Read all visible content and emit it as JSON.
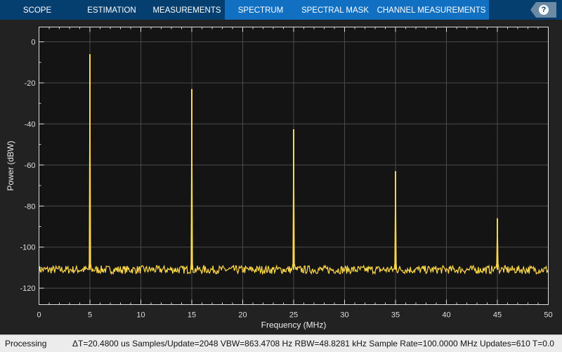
{
  "tabs": [
    {
      "label": "SCOPE",
      "active": false
    },
    {
      "label": "ESTIMATION",
      "active": false
    },
    {
      "label": "MEASUREMENTS",
      "active": false
    },
    {
      "label": "SPECTRUM",
      "active": true
    },
    {
      "label": "SPECTRAL MASK",
      "active": true
    },
    {
      "label": "CHANNEL MEASUREMENTS",
      "active": true
    }
  ],
  "help_icon": "question-mark-icon",
  "help_label": "?",
  "colors": {
    "trace": "#ffd94a",
    "plot_bg": "#141414",
    "grid": "#4a4a4a",
    "tabbar": "#043f6f",
    "tab_active": "#1170c1"
  },
  "chart_data": {
    "type": "line",
    "xlabel": "Frequency (MHz)",
    "ylabel": "Power (dBW)",
    "xlim": [
      0,
      50
    ],
    "ylim": [
      -128,
      7.2
    ],
    "xticks": [
      "0",
      "5",
      "10",
      "15",
      "20",
      "25",
      "30",
      "35",
      "40",
      "45",
      "50"
    ],
    "yticks": [
      "0",
      "-20",
      "-40",
      "-60",
      "-80",
      "-100",
      "-120"
    ],
    "grid": true,
    "noise_floor": -111,
    "peaks": [
      {
        "x": 5,
        "y": -6
      },
      {
        "x": 15,
        "y": -23
      },
      {
        "x": 25,
        "y": -42.6
      },
      {
        "x": 35,
        "y": -63
      },
      {
        "x": 45,
        "y": -86
      }
    ]
  },
  "status": {
    "state": "Processing",
    "info": "ΔT=20.4800 us  Samples/Update=2048  VBW=863.4708 Hz  RBW=48.8281 kHz  Sample Rate=100.0000 MHz  Updates=610  T=0.0"
  }
}
